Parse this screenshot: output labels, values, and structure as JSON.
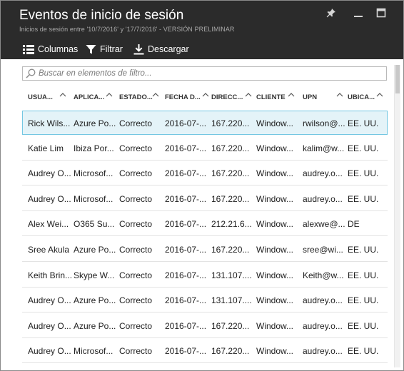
{
  "header": {
    "title": "Eventos de inicio de sesión",
    "subtitle": "Inicios de sesión entre '10/7/2016' y '17/7/2016' - VERSIÓN PRELIMINAR",
    "pin_icon": "pin-icon",
    "minimize_icon": "minimize-icon",
    "maximize_icon": "maximize-icon"
  },
  "toolbar": {
    "columns_label": "Columnas",
    "filter_label": "Filtrar",
    "download_label": "Descargar"
  },
  "search": {
    "placeholder": "Buscar en elementos de filtro..."
  },
  "table": {
    "headers": [
      "USUA...",
      "APLICA...",
      "ESTADO...",
      "FECHA D...",
      "DIRECC...",
      "CLIENTE",
      "UPN",
      "UBICA..."
    ],
    "rows": [
      [
        "Rick Wils...",
        "Azure Po...",
        "Correcto",
        "2016-07-...",
        "167.220...",
        "Window...",
        "rwilson@...",
        "EE. UU."
      ],
      [
        "Katie Lim",
        "Ibiza Por...",
        "Correcto",
        "2016-07-...",
        "167.220...",
        "Window...",
        "kalim@w...",
        "EE. UU."
      ],
      [
        "Audrey O...",
        "Microsof...",
        "Correcto",
        "2016-07-...",
        "167.220...",
        "Window...",
        "audrey.o...",
        "EE. UU."
      ],
      [
        "Audrey O...",
        "Microsof...",
        "Correcto",
        "2016-07-...",
        "167.220...",
        "Window...",
        "audrey.o...",
        "EE. UU."
      ],
      [
        "Alex Wei...",
        "O365 Su...",
        "Correcto",
        "2016-07-...",
        "212.21.6...",
        "Window...",
        "alexwe@...",
        "DE"
      ],
      [
        "Sree Akula",
        "Azure Po...",
        "Correcto",
        "2016-07-...",
        "167.220...",
        "Window...",
        "sree@wi...",
        "EE. UU."
      ],
      [
        "Keith Brin...",
        "Skype W...",
        "Correcto",
        "2016-07-...",
        "131.107....",
        "Window...",
        "Keith@w...",
        "EE. UU."
      ],
      [
        "Audrey O...",
        "Azure Po...",
        "Correcto",
        "2016-07-...",
        "131.107....",
        "Window...",
        "audrey.o...",
        "EE. UU."
      ],
      [
        "Audrey O...",
        "Azure Po...",
        "Correcto",
        "2016-07-...",
        "167.220...",
        "Window...",
        "audrey.o...",
        "EE. UU."
      ],
      [
        "Audrey O...",
        "Microsof...",
        "Correcto",
        "2016-07-...",
        "167.220...",
        "Window...",
        "audrey.o...",
        "EE. UU."
      ]
    ],
    "selected_row": 0
  },
  "colors": {
    "header_bg": "#2b2b2b",
    "selected_row_bg": "#e4f3f8",
    "selected_row_border": "#74c7e2"
  }
}
